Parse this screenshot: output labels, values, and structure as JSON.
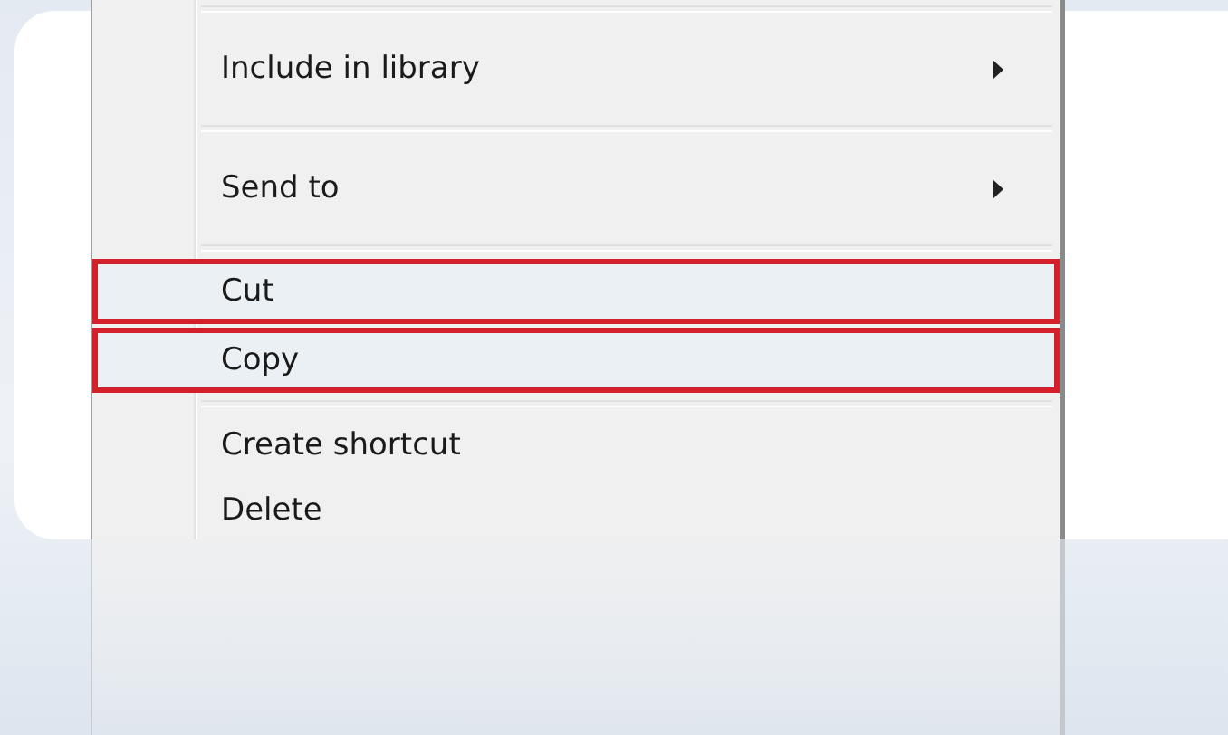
{
  "menu": {
    "items": [
      {
        "kind": "separator"
      },
      {
        "kind": "submenu",
        "label": "Include in library",
        "selected": false
      },
      {
        "kind": "separator"
      },
      {
        "kind": "submenu",
        "label": "Send to",
        "selected": false
      },
      {
        "kind": "separator"
      },
      {
        "kind": "plain",
        "label": "Cut",
        "selected": true
      },
      {
        "kind": "plain",
        "label": "Copy",
        "selected": true
      },
      {
        "kind": "separator"
      },
      {
        "kind": "plain",
        "label": "Create shortcut",
        "selected": false
      },
      {
        "kind": "plain",
        "label": "Delete",
        "selected": false
      }
    ]
  }
}
